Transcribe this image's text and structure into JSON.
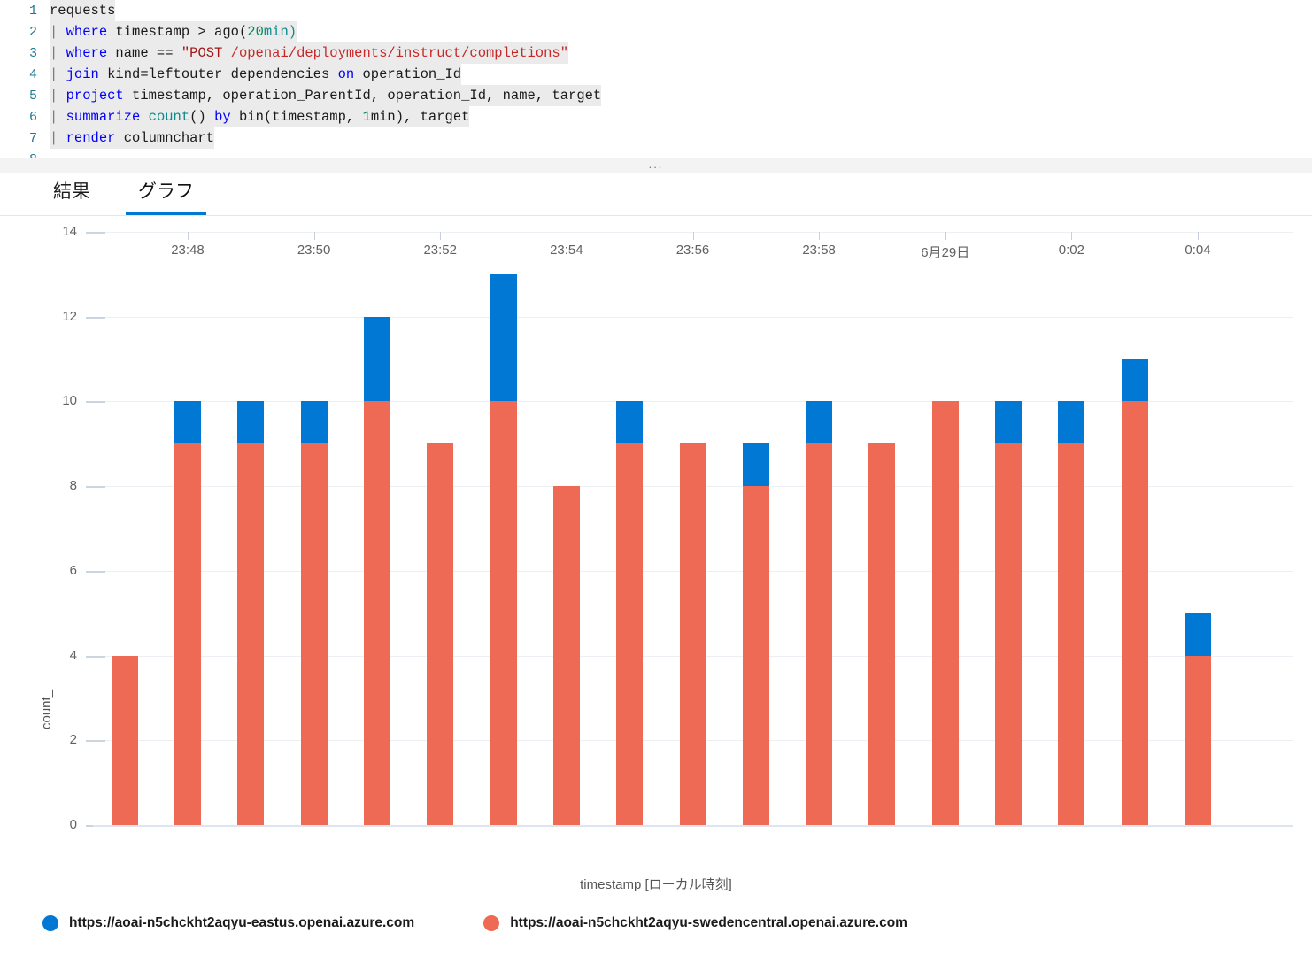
{
  "editor": {
    "expand_indicator": "...",
    "lines": [
      {
        "n": "1",
        "tokens": [
          {
            "t": "requests",
            "c": "pln"
          }
        ]
      },
      {
        "n": "2",
        "tokens": [
          {
            "t": "| ",
            "c": "pipe"
          },
          {
            "t": "where",
            "c": "kw"
          },
          {
            "t": " timestamp > ago(",
            "c": "pln"
          },
          {
            "t": "20",
            "c": "num"
          },
          {
            "t": "min)",
            "c": "fn"
          }
        ]
      },
      {
        "n": "3",
        "tokens": [
          {
            "t": "| ",
            "c": "pipe"
          },
          {
            "t": "where",
            "c": "kw"
          },
          {
            "t": " name == ",
            "c": "pln"
          },
          {
            "t": "\"POST ",
            "c": "str"
          },
          {
            "t": "/openai/deployments/instruct/completions\"",
            "c": "red"
          }
        ]
      },
      {
        "n": "4",
        "tokens": [
          {
            "t": "| ",
            "c": "pipe"
          },
          {
            "t": "join",
            "c": "kw"
          },
          {
            "t": " kind=leftouter dependencies ",
            "c": "pln"
          },
          {
            "t": "on",
            "c": "kw"
          },
          {
            "t": " operation_Id",
            "c": "pln"
          }
        ]
      },
      {
        "n": "5",
        "tokens": [
          {
            "t": "| ",
            "c": "pipe"
          },
          {
            "t": "project",
            "c": "kw"
          },
          {
            "t": " timestamp, operation_ParentId, operation_Id, name, target",
            "c": "pln"
          }
        ]
      },
      {
        "n": "6",
        "tokens": [
          {
            "t": "| ",
            "c": "pipe"
          },
          {
            "t": "summarize",
            "c": "kw"
          },
          {
            "t": " ",
            "c": "pln"
          },
          {
            "t": "count",
            "c": "fn"
          },
          {
            "t": "() ",
            "c": "pln"
          },
          {
            "t": "by",
            "c": "kw"
          },
          {
            "t": " bin(timestamp, ",
            "c": "pln"
          },
          {
            "t": "1",
            "c": "num"
          },
          {
            "t": "min), target",
            "c": "pln"
          }
        ]
      },
      {
        "n": "7",
        "tokens": [
          {
            "t": "| ",
            "c": "pipe"
          },
          {
            "t": "render",
            "c": "kw"
          },
          {
            "t": " columnchart",
            "c": "pln"
          }
        ]
      }
    ]
  },
  "tabs": [
    {
      "label": "結果",
      "active": false
    },
    {
      "label": "グラフ",
      "active": true
    }
  ],
  "colors": {
    "eastus_blue": "#0078d4",
    "swedencentral_red": "#ee6a55",
    "tab_accent": "#0078d4",
    "gridline": "#eceff3"
  },
  "legend": [
    {
      "label": "https://aoai-n5chckht2aqyu-eastus.openai.azure.com",
      "color": "#0078d4"
    },
    {
      "label": "https://aoai-n5chckht2aqyu-swedencentral.openai.azure.com",
      "color": "#ee6a55"
    }
  ],
  "chart_data": {
    "type": "bar",
    "stacked": true,
    "title": "",
    "xlabel": "timestamp [ローカル時刻]",
    "ylabel": "count_",
    "ylim": [
      0,
      14
    ],
    "yticks": [
      0,
      2,
      4,
      6,
      8,
      10,
      12,
      14
    ],
    "ytick_labels": [
      "0",
      "2",
      "4",
      "6",
      "8",
      "10",
      "12",
      "14"
    ],
    "grid": true,
    "legend_position": "bottom-left",
    "x_slots": 19,
    "xtick_slots": [
      1,
      3,
      5,
      7,
      9,
      11,
      13,
      15,
      17
    ],
    "xtick_labels": [
      "23:48",
      "23:50",
      "23:52",
      "23:54",
      "23:56",
      "23:58",
      "6月29日",
      "0:02",
      "0:04"
    ],
    "categories": [
      "23:47",
      "23:48",
      "23:49",
      "23:50",
      "23:51",
      "23:52",
      "23:53",
      "23:54",
      "23:55",
      "23:56",
      "23:57",
      "23:58",
      "23:59",
      "0:00",
      "0:01",
      "0:02",
      "0:03",
      "0:04",
      "0:05"
    ],
    "series": [
      {
        "name": "https://aoai-n5chckht2aqyu-swedencentral.openai.azure.com",
        "color": "#ee6a55",
        "values": [
          4,
          9,
          9,
          9,
          10,
          9,
          10,
          8,
          9,
          9,
          8,
          9,
          9,
          10,
          9,
          9,
          10,
          4,
          null
        ]
      },
      {
        "name": "https://aoai-n5chckht2aqyu-eastus.openai.azure.com",
        "color": "#0078d4",
        "values": [
          0,
          1,
          1,
          1,
          2,
          0,
          3,
          0,
          1,
          0,
          1,
          1,
          0,
          0,
          1,
          1,
          1,
          1,
          null
        ]
      }
    ],
    "totals": [
      4,
      10,
      10,
      10,
      12,
      9,
      13,
      8,
      10,
      9,
      9,
      10,
      9,
      10,
      10,
      10,
      11,
      5,
      null
    ]
  }
}
